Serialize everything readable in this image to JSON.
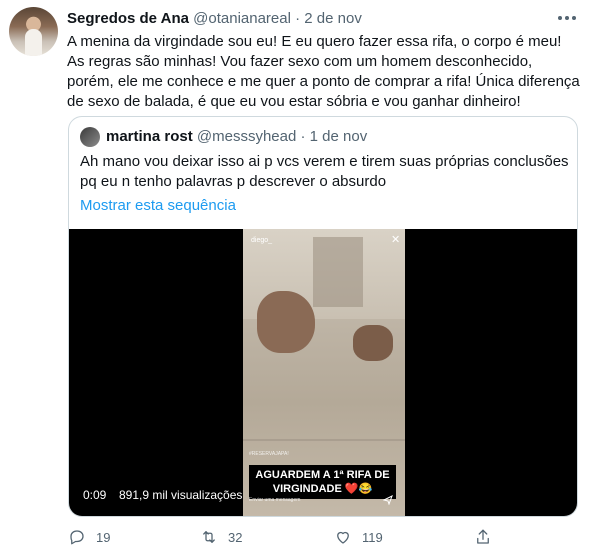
{
  "tweet": {
    "author_name": "Segredos de Ana",
    "author_handle": "@otanianareal",
    "separator": "·",
    "date": "2 de nov",
    "text": "A menina da virgindade sou eu! E eu quero fazer essa rifa, o corpo é meu! As regras são minhas! Vou fazer sexo com um homem desconhecido, porém, ele me conhece e me quer a ponto de comprar a rifa! Única diferença de sexo de balada, é que eu vou estar sóbria e vou ganhar dinheiro!"
  },
  "quoted": {
    "author_name": "martina rost",
    "author_handle": "@messsyhead",
    "separator": "·",
    "date": "1 de nov",
    "text": "Ah mano vou deixar isso ai p vcs verem e tirem suas próprias conclusões pq eu n tenho palavras p descrever o absurdo",
    "show_thread": "Mostrar esta sequência",
    "video": {
      "time": "0:09",
      "views": "891,9 mil visualizações",
      "story_user": "diego_",
      "story_watermark": "#RESERVAJAPA!",
      "caption": "AGUARDEM A 1ª RIFA DE VIRGINDADE ❤️😂",
      "send_prompt": "Enviar uma mensagem"
    }
  },
  "actions": {
    "reply_count": "19",
    "retweet_count": "32",
    "like_count": "119",
    "icons": [
      "reply-icon",
      "retweet-icon",
      "like-icon",
      "share-icon"
    ]
  },
  "colors": {
    "link": "#1d9bf0",
    "muted": "#536471",
    "border": "#cfd9de"
  }
}
